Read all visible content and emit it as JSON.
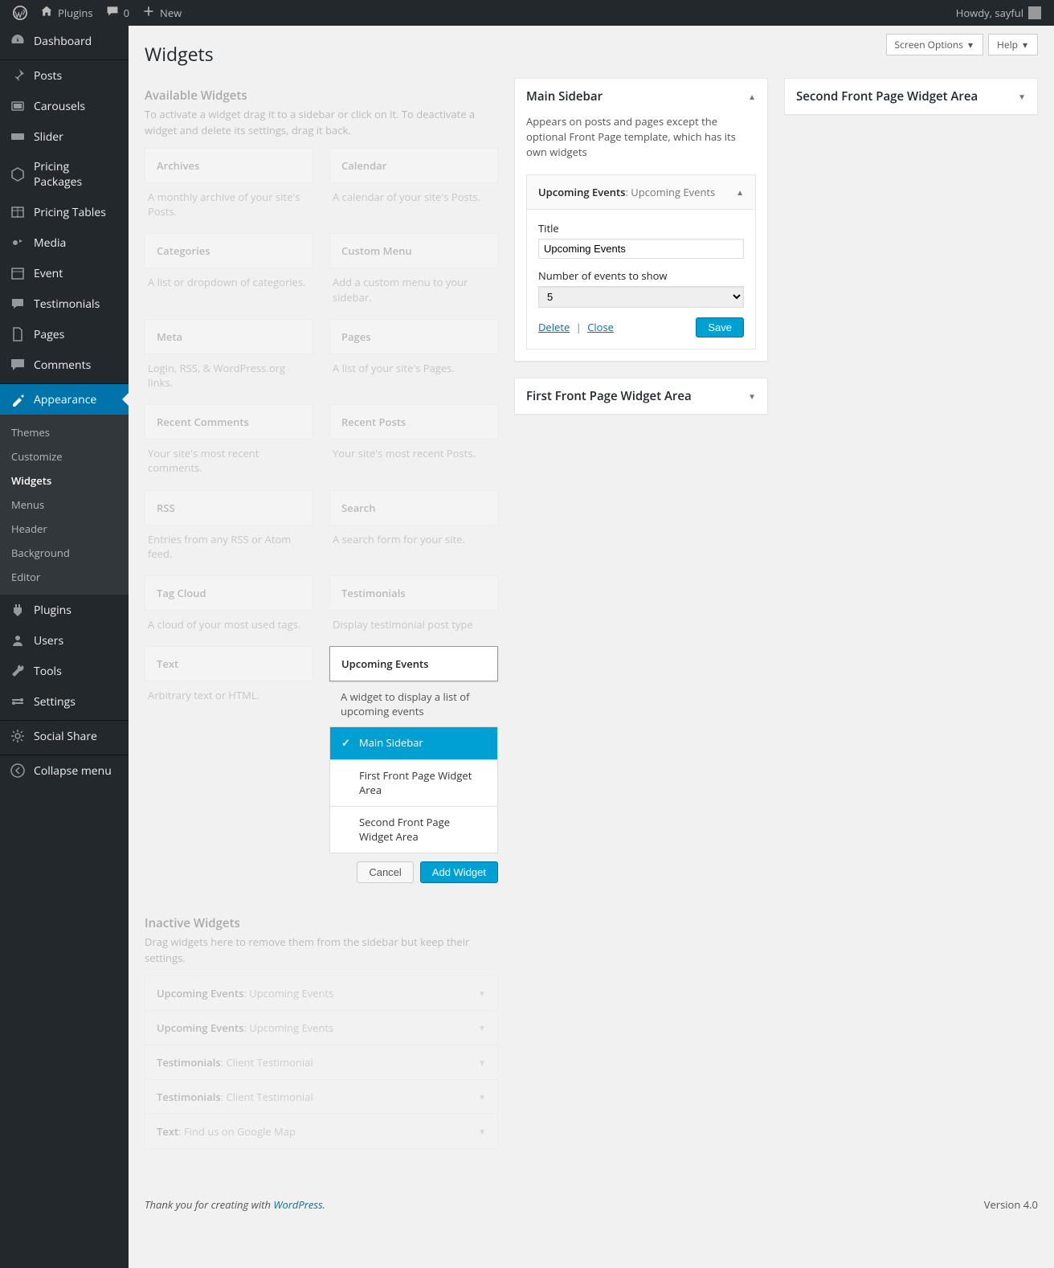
{
  "adminbar": {
    "site": "Plugins",
    "comments": "0",
    "new": "New",
    "howdy": "Howdy, sayful"
  },
  "sidebar": {
    "items": [
      {
        "label": "Dashboard",
        "icon": "dashboard"
      },
      {
        "label": "Posts",
        "icon": "pin"
      },
      {
        "label": "Carousels",
        "icon": "carousel"
      },
      {
        "label": "Slider",
        "icon": "slider"
      },
      {
        "label": "Pricing Packages",
        "icon": "package"
      },
      {
        "label": "Pricing Tables",
        "icon": "table"
      },
      {
        "label": "Media",
        "icon": "media"
      },
      {
        "label": "Event",
        "icon": "calendar"
      },
      {
        "label": "Testimonials",
        "icon": "testimonials"
      },
      {
        "label": "Pages",
        "icon": "pages"
      },
      {
        "label": "Comments",
        "icon": "comment"
      }
    ],
    "appearance": {
      "label": "Appearance",
      "submenu": [
        "Themes",
        "Customize",
        "Widgets",
        "Menus",
        "Header",
        "Background",
        "Editor"
      ],
      "current": "Widgets"
    },
    "items2": [
      {
        "label": "Plugins",
        "icon": "plugin"
      },
      {
        "label": "Users",
        "icon": "users"
      },
      {
        "label": "Tools",
        "icon": "tools"
      },
      {
        "label": "Settings",
        "icon": "settings"
      }
    ],
    "items3": [
      {
        "label": "Social Share",
        "icon": "gear"
      }
    ],
    "collapse": "Collapse menu"
  },
  "topbuttons": {
    "screenOptions": "Screen Options",
    "help": "Help"
  },
  "page": {
    "title": "Widgets",
    "available": {
      "heading": "Available Widgets",
      "desc": "To activate a widget drag it to a sidebar or click on it. To deactivate a widget and delete its settings, drag it back.",
      "widgets": [
        {
          "name": "Archives",
          "desc": "A monthly archive of your site's Posts."
        },
        {
          "name": "Calendar",
          "desc": "A calendar of your site's Posts."
        },
        {
          "name": "Categories",
          "desc": "A list or dropdown of categories."
        },
        {
          "name": "Custom Menu",
          "desc": "Add a custom menu to your sidebar."
        },
        {
          "name": "Meta",
          "desc": "Login, RSS, & WordPress.org links."
        },
        {
          "name": "Pages",
          "desc": "A list of your site's Pages."
        },
        {
          "name": "Recent Comments",
          "desc": "Your site's most recent comments."
        },
        {
          "name": "Recent Posts",
          "desc": "Your site's most recent Posts."
        },
        {
          "name": "RSS",
          "desc": "Entries from any RSS or Atom feed."
        },
        {
          "name": "Search",
          "desc": "A search form for your site."
        },
        {
          "name": "Tag Cloud",
          "desc": "A cloud of your most used tags."
        },
        {
          "name": "Testimonials",
          "desc": "Display testimonial post type"
        },
        {
          "name": "Text",
          "desc": "Arbitrary text or HTML."
        }
      ]
    },
    "chooser": {
      "widgetName": "Upcoming Events",
      "desc": "A widget to display a list of upcoming events",
      "areas": [
        "Main Sidebar",
        "First Front Page Widget Area",
        "Second Front Page Widget Area"
      ],
      "selected": "Main Sidebar",
      "cancel": "Cancel",
      "add": "Add Widget"
    },
    "mainSidebar": {
      "title": "Main Sidebar",
      "desc": "Appears on posts and pages except the optional Front Page template, which has its own widgets",
      "widget": {
        "name": "Upcoming Events",
        "instance": "Upcoming Events",
        "form": {
          "titleLabel": "Title",
          "titleValue": "Upcoming Events",
          "countLabel": "Number of events to show",
          "countValue": "5"
        },
        "delete": "Delete",
        "close": "Close",
        "save": "Save"
      }
    },
    "firstFront": {
      "title": "First Front Page Widget Area"
    },
    "secondFront": {
      "title": "Second Front Page Widget Area"
    },
    "inactive": {
      "heading": "Inactive Widgets",
      "desc": "Drag widgets here to remove them from the sidebar but keep their settings.",
      "items": [
        {
          "name": "Upcoming Events",
          "sub": "Upcoming Events"
        },
        {
          "name": "Upcoming Events",
          "sub": "Upcoming Events"
        },
        {
          "name": "Testimonials",
          "sub": "Client Testimonial"
        },
        {
          "name": "Testimonials",
          "sub": "Client Testimonial"
        },
        {
          "name": "Text",
          "sub": "Find us on Google Map"
        }
      ]
    }
  },
  "footer": {
    "thanks_pre": "Thank you for creating with ",
    "thanks_link": "WordPress",
    "thanks_post": ".",
    "version": "Version 4.0"
  }
}
